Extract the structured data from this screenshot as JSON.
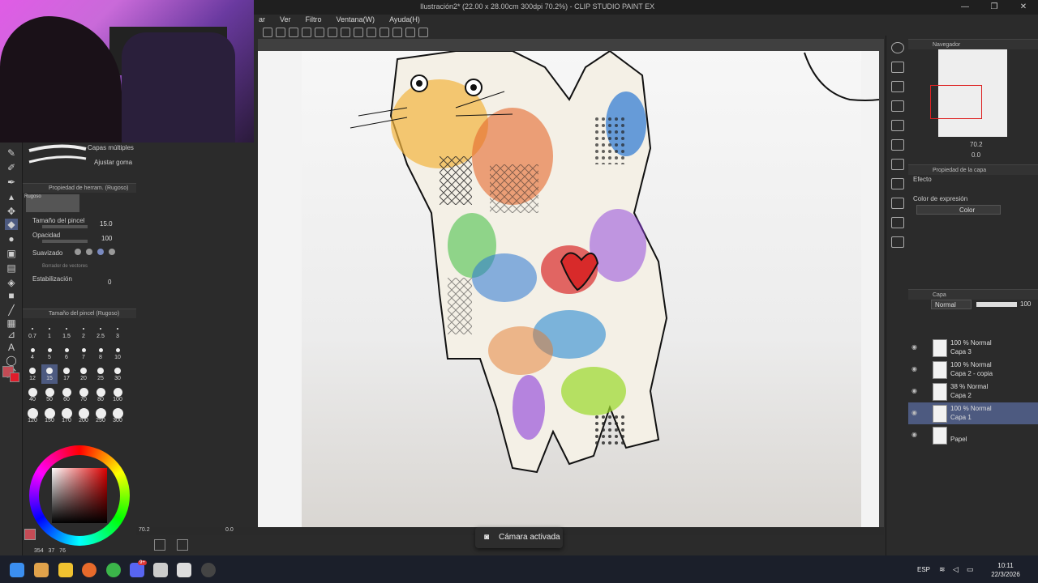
{
  "window": {
    "title": "Ilustración2* (22.00 x 28.00cm 300dpi 70.2%) - CLIP STUDIO PAINT EX",
    "controls": [
      "—",
      "❐",
      "✕"
    ]
  },
  "menu": [
    "ar",
    "Ver",
    "Filtro",
    "Ventana(W)",
    "Ayuda(H)"
  ],
  "brush_panel": {
    "subtool_multi": "Capas múltiples",
    "subtool_adjust": "Ajustar goma",
    "tool_property_header": "Propiedad de herram. (Rugoso)",
    "brush_name": "Rugoso",
    "brush_size_label": "Tamaño del pincel",
    "brush_size_value": "15.0",
    "opacity_label": "Opacidad",
    "opacity_value": "100",
    "smoothing_label": "Suavizado",
    "vector_eraser_label": "Borrador de vectores",
    "stabilization_label": "Estabilización",
    "stabilization_value": "0",
    "size_panel_header": "Tamaño del pincel (Rugoso)",
    "sizes": [
      "0.7",
      "1",
      "1.5",
      "2",
      "2.5",
      "3",
      "4",
      "5",
      "6",
      "7",
      "8",
      "10",
      "12",
      "15",
      "17",
      "20",
      "25",
      "30",
      "40",
      "50",
      "60",
      "70",
      "80",
      "100",
      "120",
      "150",
      "170",
      "200",
      "250",
      "300"
    ]
  },
  "color": {
    "main": "#c44b55",
    "sub": "#e01d2b",
    "hsv_readout": [
      "354",
      "37",
      "76"
    ]
  },
  "statusbar": {
    "zoom": "70.2",
    "angle": "0.0"
  },
  "navigator": {
    "header": "Navegador",
    "zoom": "70.2",
    "angle": "0.0"
  },
  "layer_property": {
    "header": "Propiedad de la capa",
    "effect_label": "Efecto",
    "expression_label": "Color de expresión",
    "expression_value": "Color"
  },
  "layers": {
    "header": "Capa",
    "blend_mode": "Normal",
    "opacity": "100",
    "items": [
      {
        "mode": "100 % Normal",
        "name": "Capa 3",
        "selected": false
      },
      {
        "mode": "100 % Normal",
        "name": "Capa 2 - copia",
        "selected": false
      },
      {
        "mode": "38 % Normal",
        "name": "Capa 2",
        "selected": false
      },
      {
        "mode": "100 % Normal",
        "name": "Capa 1",
        "selected": true
      },
      {
        "mode": "",
        "name": "Papel",
        "selected": false
      }
    ]
  },
  "toast": {
    "text": "Cámara activada",
    "icon": "camera-icon"
  },
  "taskbar": {
    "language": "ESP",
    "time": "10:11",
    "date": "22/3/2026",
    "badge": "9+"
  }
}
